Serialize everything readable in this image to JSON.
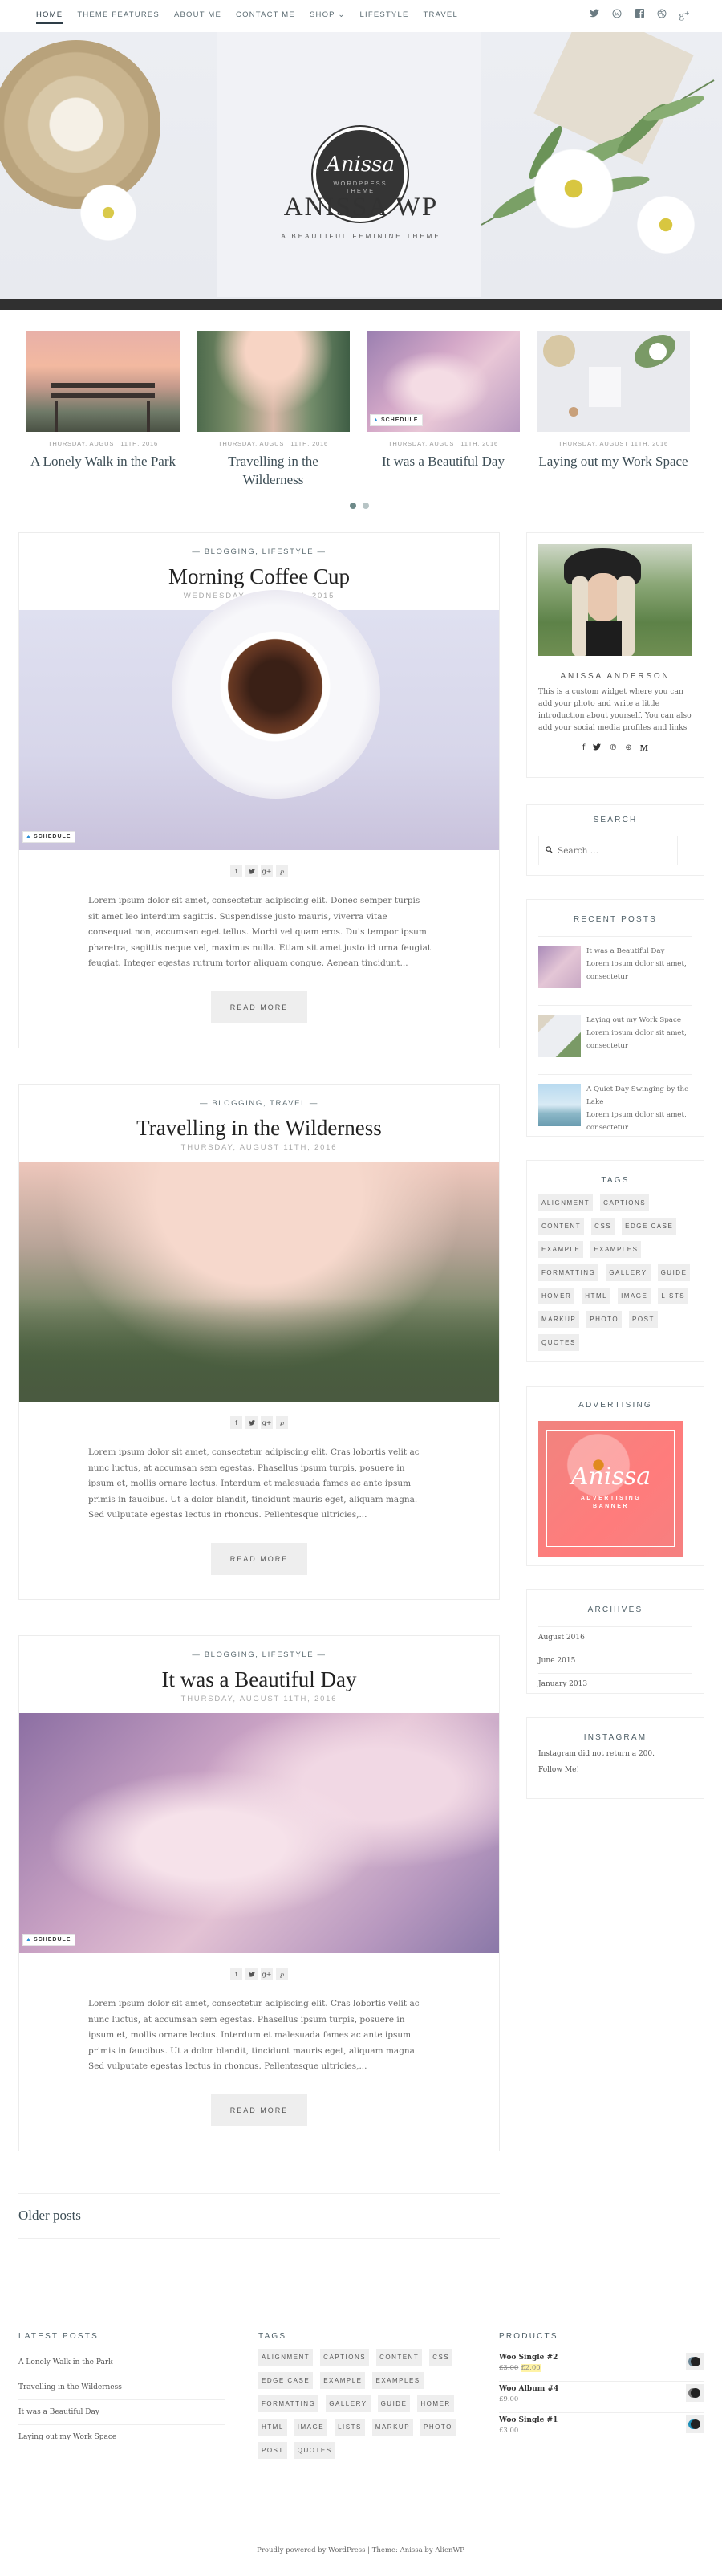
{
  "nav": {
    "items": [
      {
        "label": "HOME",
        "active": true
      },
      {
        "label": "THEME FEATURES",
        "active": false
      },
      {
        "label": "ABOUT ME",
        "active": false
      },
      {
        "label": "CONTACT ME",
        "active": false
      },
      {
        "label": "SHOP ⌄",
        "active": false
      },
      {
        "label": "LIFESTYLE",
        "active": false
      },
      {
        "label": "TRAVEL",
        "active": false
      }
    ],
    "social": [
      {
        "name": "twitter-icon",
        "glyph": "🐦"
      },
      {
        "name": "wordpress-icon",
        "glyph": "Ⓦ"
      },
      {
        "name": "facebook-icon",
        "glyph": "f"
      },
      {
        "name": "dribbble-icon",
        "glyph": "⊛"
      },
      {
        "name": "google-plus-icon",
        "glyph": "g+"
      }
    ]
  },
  "header": {
    "logo_script": "Anissa",
    "logo_sub": "WORDPRESS THEME",
    "site_title": "ANISSA WP",
    "tagline": "A BEAUTIFUL FEMININE THEME"
  },
  "slider": {
    "slides": [
      {
        "date": "THURSDAY, AUGUST 11TH, 2016",
        "title": "A Lonely Walk in the Park",
        "badge": ""
      },
      {
        "date": "THURSDAY, AUGUST 11TH, 2016",
        "title": "Travelling in the Wilderness",
        "badge": ""
      },
      {
        "date": "THURSDAY, AUGUST 11TH, 2016",
        "title": "It was a Beautiful Day",
        "badge": "SCHEDULE"
      },
      {
        "date": "THURSDAY, AUGUST 11TH, 2016",
        "title": "Laying out my Work Space",
        "badge": ""
      }
    ],
    "pages": 2,
    "current_page": 1
  },
  "posts": [
    {
      "cats": "— BLOGGING, LIFESTYLE —",
      "title": "Morning Coffee Cup",
      "date": "WEDNESDAY, JUNE 17TH, 2015",
      "badge": "SCHEDULE",
      "excerpt": "Lorem ipsum dolor sit amet, consectetur adipiscing elit. Donec semper turpis sit amet leo interdum sagittis. Suspendisse justo mauris, viverra vitae consequat non, accumsan eget tellus. Morbi vel quam eros. Duis tempor ipsum pharetra, sagittis neque vel, maximus nulla. Etiam sit amet justo id urna feugiat feugiat. Integer egestas rutrum tortor aliquam congue. Aenean tincidunt...",
      "read_more": "READ MORE"
    },
    {
      "cats": "— BLOGGING, TRAVEL —",
      "title": "Travelling in the Wilderness",
      "date": "THURSDAY, AUGUST 11TH, 2016",
      "badge": "",
      "excerpt": "Lorem ipsum dolor sit amet, consectetur adipiscing elit. Cras lobortis velit ac nunc luctus, at accumsan sem egestas. Phasellus ipsum turpis, posuere in ipsum et, mollis ornare lectus. Interdum et malesuada fames ac ante ipsum primis in faucibus. Ut a dolor blandit, tincidunt mauris eget, aliquam magna. Sed vulputate egestas lectus in rhoncus. Pellentesque ultricies,...",
      "read_more": "READ MORE"
    },
    {
      "cats": "— BLOGGING, LIFESTYLE —",
      "title": "It was a Beautiful Day",
      "date": "THURSDAY, AUGUST 11TH, 2016",
      "badge": "SCHEDULE",
      "excerpt": "Lorem ipsum dolor sit amet, consectetur adipiscing elit. Cras lobortis velit ac nunc luctus, at accumsan sem egestas. Phasellus ipsum turpis, posuere in ipsum et, mollis ornare lectus. Interdum et malesuada fames ac ante ipsum primis in faucibus. Ut a dolor blandit, tincidunt mauris eget, aliquam magna. Sed vulputate egestas lectus in rhoncus. Pellentesque ultricies,...",
      "read_more": "READ MORE"
    }
  ],
  "share_icons": [
    "f",
    "🐦",
    "g+",
    "℘"
  ],
  "pagination": {
    "older": "Older posts"
  },
  "sidebar": {
    "about": {
      "name": "ANISSA ANDERSON",
      "text": "This is a custom widget where you can add your photo and write a little introduction about yourself. You can also add your social media profiles and links",
      "social": [
        "f",
        "🐦",
        "℗",
        "⊛",
        "M"
      ]
    },
    "search": {
      "title": "SEARCH",
      "placeholder": "Search …"
    },
    "recent": {
      "title": "RECENT POSTS",
      "items": [
        {
          "title": "It was a Beautiful Day",
          "excerpt": "Lorem ipsum dolor sit amet, consectetur"
        },
        {
          "title": "Laying out my Work Space",
          "excerpt": "Lorem ipsum dolor sit amet, consectetur"
        },
        {
          "title": "A Quiet Day Swinging by the Lake",
          "excerpt": "Lorem ipsum dolor sit amet, consectetur"
        }
      ]
    },
    "tags": {
      "title": "TAGS",
      "items": [
        "ALIGNMENT",
        "CAPTIONS",
        "CONTENT",
        "CSS",
        "EDGE CASE",
        "EXAMPLE",
        "EXAMPLES",
        "FORMATTING",
        "GALLERY",
        "GUIDE",
        "HOMER",
        "HTML",
        "IMAGE",
        "LISTS",
        "MARKUP",
        "PHOTO",
        "POST",
        "QUOTES"
      ]
    },
    "ad": {
      "title": "ADVERTISING",
      "script": "Anissa",
      "line1": "ADVERTISING",
      "line2": "BANNER"
    },
    "archives": {
      "title": "ARCHIVES",
      "items": [
        "August 2016",
        "June 2015",
        "January 2013"
      ]
    },
    "instagram": {
      "title": "INSTAGRAM",
      "error": "Instagram did not return a 200.",
      "follow": "Follow Me!"
    }
  },
  "footer": {
    "latest": {
      "title": "LATEST POSTS",
      "items": [
        "A Lonely Walk in the Park",
        "Travelling in the Wilderness",
        "It was a Beautiful Day",
        "Laying out my Work Space"
      ]
    },
    "tags": {
      "title": "TAGS",
      "items": [
        "ALIGNMENT",
        "CAPTIONS",
        "CONTENT",
        "CSS",
        "EDGE CASE",
        "EXAMPLE",
        "EXAMPLES",
        "FORMATTING",
        "GALLERY",
        "GUIDE",
        "HOMER",
        "HTML",
        "IMAGE",
        "LISTS",
        "MARKUP",
        "PHOTO",
        "POST",
        "QUOTES"
      ]
    },
    "products": {
      "title": "PRODUCTS",
      "items": [
        {
          "name": "Woo Single #2",
          "old_price": "£3.00",
          "price": "£2.00"
        },
        {
          "name": "Woo Album #4",
          "old_price": "",
          "price": "£9.00"
        },
        {
          "name": "Woo Single #1",
          "old_price": "",
          "price": "£3.00"
        }
      ]
    },
    "credit": "Proudly powered by WordPress | Theme: Anissa by AlienWP."
  },
  "colors": {
    "accent": "#2e3d47",
    "dark_bar": "#303030",
    "ad_banner": "#ff7c7c",
    "tag_bg": "#eeeeee"
  }
}
